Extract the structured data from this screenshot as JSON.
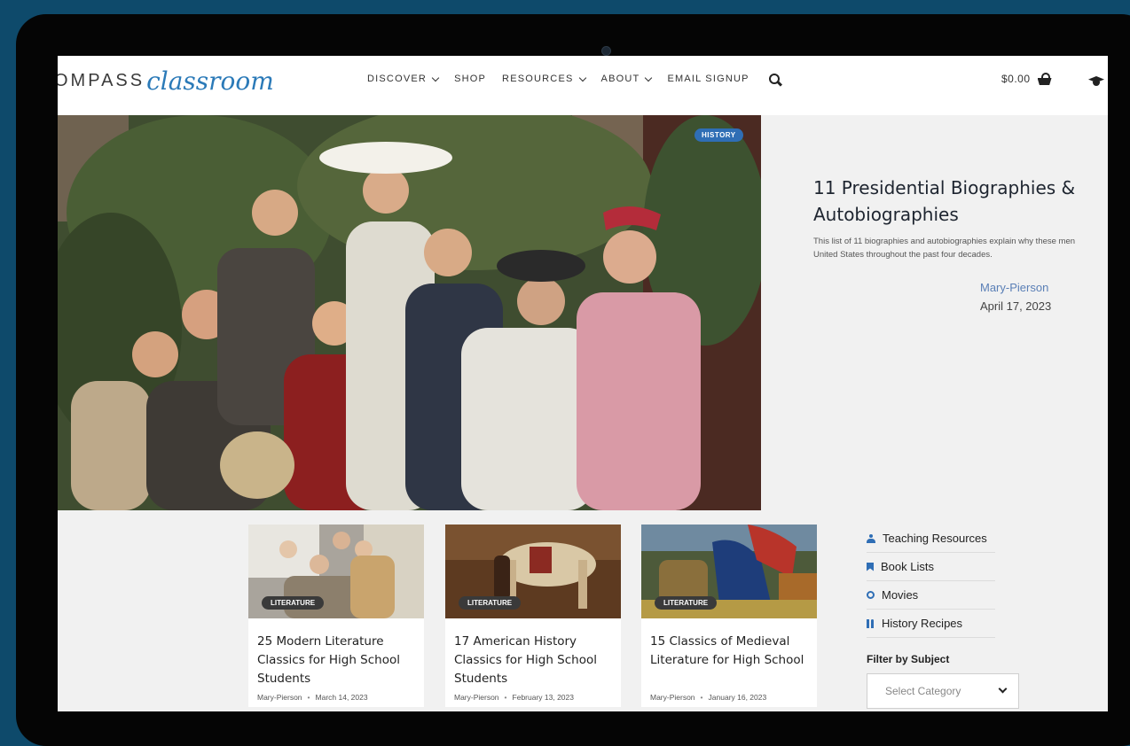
{
  "brand": {
    "logo_left": "OMPASS",
    "logo_right": "classroom"
  },
  "nav": {
    "items": [
      {
        "label": "DISCOVER",
        "has_dropdown": true
      },
      {
        "label": "SHOP",
        "has_dropdown": false
      },
      {
        "label": "RESOURCES",
        "has_dropdown": true
      },
      {
        "label": "ABOUT",
        "has_dropdown": true
      },
      {
        "label": "EMAIL SIGNUP",
        "has_dropdown": false
      }
    ]
  },
  "cart": {
    "total": "$0.00"
  },
  "feature": {
    "badge": "HISTORY",
    "title": "11 Presidential Biographies & Autobiographies",
    "excerpt": "This list of 11 biographies and autobiographies explain why these men\nUnited States throughout the past four decades.",
    "author": "Mary-Pierson",
    "date": "April 17, 2023"
  },
  "cards": [
    {
      "badge": "LITERATURE",
      "title": "25 Modern Literature Classics for High School Students",
      "author": "Mary-Pierson",
      "date": "March 14, 2023"
    },
    {
      "badge": "LITERATURE",
      "title": "17 American History Classics for High School Students",
      "author": "Mary-Pierson",
      "date": "February 13, 2023"
    },
    {
      "badge": "LITERATURE",
      "title": "15 Classics of Medieval Literature for High School",
      "author": "Mary-Pierson",
      "date": "January 16, 2023"
    }
  ],
  "sidebar": {
    "links": [
      {
        "label": "Teaching Resources",
        "icon": "people-icon"
      },
      {
        "label": "Book Lists",
        "icon": "bookmark-icon"
      },
      {
        "label": "Movies",
        "icon": "movie-icon"
      },
      {
        "label": "History Recipes",
        "icon": "utensils-icon"
      }
    ],
    "filter_title": "Filter by Subject",
    "select_value": "Select Category"
  },
  "colors": {
    "accent": "#2f6eb5",
    "link": "#5a7fb6",
    "background": "#0e4a6b"
  }
}
